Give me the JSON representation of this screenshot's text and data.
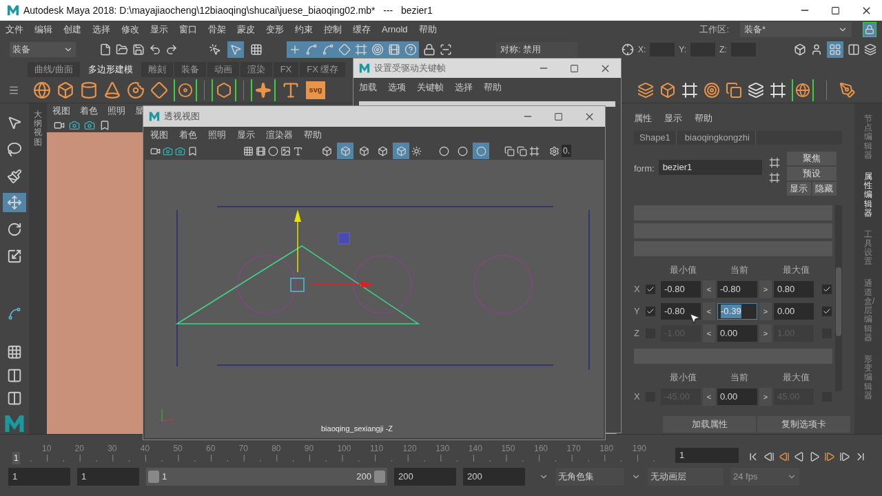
{
  "title_bar": {
    "title": "Autodesk Maya 2018: D:\\mayajiaocheng\\12biaoqing\\shucai\\juese_biaoqing02.mb*   ---   bezier1"
  },
  "menu_bar": {
    "items": [
      "文件",
      "编辑",
      "创建",
      "选择",
      "修改",
      "显示",
      "窗口",
      "骨架",
      "蒙皮",
      "变形",
      "约束",
      "控制",
      "缓存",
      "Arnold",
      "帮助"
    ],
    "workspace_label": "工作区:",
    "workspace_value": "装备*"
  },
  "status_line": {
    "menu_set": "装备",
    "select_modes": [
      {
        "on": false
      },
      {
        "on": true
      },
      {
        "on": false
      }
    ],
    "snaps": [
      {
        "on": true
      },
      {
        "on": true
      },
      {
        "on": true
      },
      {
        "on": true
      },
      {
        "on": true
      },
      {
        "on": true
      },
      {
        "on": true
      },
      {
        "on": true
      }
    ],
    "symmetry": "对称: 禁用",
    "x_label": "X:",
    "y_label": "Y:",
    "z_label": "Z:"
  },
  "shelf": {
    "tabs": [
      {
        "label": "曲线/曲面",
        "selected": false
      },
      {
        "label": "多边形建模",
        "selected": true
      },
      {
        "label": "雕刻",
        "selected": false
      },
      {
        "label": "装备",
        "selected": false
      },
      {
        "label": "动画",
        "selected": false
      },
      {
        "label": "渲染",
        "selected": false
      },
      {
        "label": "FX",
        "selected": false
      },
      {
        "label": "FX 缓存",
        "selected": false
      }
    ],
    "svg_label": "svg"
  },
  "toolbox": [
    {
      "kind": "select",
      "selected": false
    },
    {
      "kind": "lasso",
      "selected": false
    },
    {
      "kind": "paint",
      "selected": false
    },
    {
      "kind": "move",
      "selected": true
    },
    {
      "kind": "rotate",
      "selected": false
    },
    {
      "kind": "scale",
      "selected": false
    }
  ],
  "outliner_tab": "大纲视图",
  "main_viewport": {
    "menu": [
      "视图",
      "着色",
      "照明",
      "显"
    ]
  },
  "driven_key_window": {
    "title": "设置受驱动关键帧",
    "menu": [
      "加载",
      "选项",
      "关键帧",
      "选择",
      "帮助"
    ]
  },
  "perspective_window": {
    "title": "透视视图",
    "menu": [
      "视图",
      "着色",
      "照明",
      "显示",
      "渲染器",
      "帮助"
    ],
    "shading_toggles": [
      {
        "on": false
      },
      {
        "on": true
      },
      {
        "on": false
      },
      {
        "on": false
      },
      {
        "on": true
      }
    ],
    "lighting_toggles": [
      {
        "on": false
      },
      {
        "on": false
      },
      {
        "on": true
      }
    ],
    "hud_value": "0.",
    "camera_label": "biaoqing_sexiangji -Z"
  },
  "attribute_editor": {
    "menu": [
      "属性",
      "显示",
      "帮助"
    ],
    "tabs": [
      "Shape1",
      "biaoqingkongzhi"
    ],
    "transform_label": "form:",
    "transform_value": "bezier1",
    "buttons": [
      "聚焦",
      "预设"
    ],
    "show_button": "显示",
    "hide_button": "隐藏",
    "translate_limits": {
      "headers": [
        "最小值",
        "当前",
        "最大值"
      ],
      "rows": [
        {
          "axis": "X",
          "min_on": true,
          "min": "-0.80",
          "less": "<",
          "current": "-0.80",
          "selected": false,
          "more": ">",
          "max": "0.80",
          "max_on": true
        },
        {
          "axis": "Y",
          "min_on": true,
          "min": "-0.80",
          "less": "<",
          "current": "-0.39",
          "selected": true,
          "more": ">",
          "max": "0.00",
          "max_on": true
        },
        {
          "axis": "Z",
          "min_on": false,
          "min": "-1.00",
          "less": "<",
          "current": "0.00",
          "selected": false,
          "more": ">",
          "max": "1.00",
          "max_on": false
        }
      ]
    },
    "rotate_limits": {
      "headers": [
        "最小值",
        "当前",
        "最大值"
      ],
      "rows": [
        {
          "axis": "X",
          "min_on": false,
          "min": "-45.00",
          "less": "<",
          "current": "0.00",
          "selected": false,
          "more": ">",
          "max": "45.00",
          "max_on": false
        }
      ]
    },
    "footer_buttons": [
      "加载属性",
      "复制选项卡"
    ]
  },
  "side_tabs": [
    {
      "label": "节点编辑器",
      "selected": false
    },
    {
      "label": "属性编辑器",
      "selected": true
    },
    {
      "label": "工具设置",
      "selected": false
    },
    {
      "label": "通道盒/层编辑器",
      "selected": false
    },
    {
      "label": "形变编辑器",
      "selected": false
    }
  ],
  "time_slider": {
    "level": 0,
    "ticks": [
      "10",
      "20",
      "30",
      "40",
      "50",
      "60",
      "70",
      "80",
      "90",
      "100",
      "110",
      "120",
      "130",
      "140",
      "150",
      "160",
      "170",
      "180",
      "190"
    ],
    "current": "1",
    "frame_field": "1"
  },
  "range_slider": {
    "level": 1,
    "start": "1",
    "inner_start": "1",
    "slider_start": "1",
    "slider_end": "200",
    "inner_end": "200",
    "end": "200",
    "character_set": "无角色集",
    "anim_layer": "无动画层",
    "fps": "24 fps"
  }
}
